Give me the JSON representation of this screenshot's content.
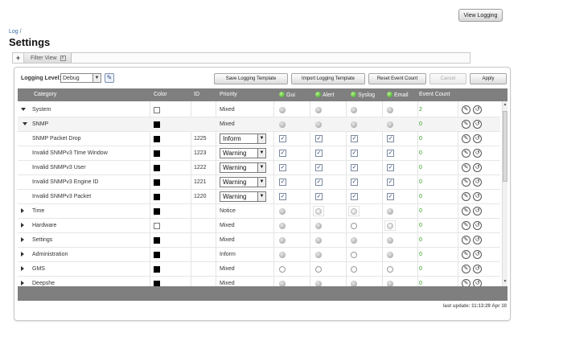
{
  "header": {
    "view_logging": "View Logging",
    "breadcrumb": "Log /",
    "title": "Settings"
  },
  "filter": {
    "add": "+",
    "tab_label": "Filter View",
    "close": "x"
  },
  "toolbar": {
    "level_label": "Logging Level:",
    "level_value": "Debug",
    "save_template": "Save Logging Template",
    "import_template": "Import Logging Template",
    "reset_count": "Reset Event Count",
    "cancel": "Cancel",
    "apply": "Apply"
  },
  "columns": {
    "category": "Category",
    "color": "Color",
    "id": "ID",
    "priority": "Priority",
    "gui": "Gui",
    "alert": "Alert",
    "syslog": "Syslog",
    "email": "Email",
    "event_count": "Event Count"
  },
  "rows": [
    {
      "name": "System",
      "color": "white",
      "id": "",
      "priority": "Mixed",
      "gui": "gray",
      "alert": "gray",
      "syslog": "gray",
      "email": "gray",
      "count": "2",
      "expand": "down",
      "indent": 0
    },
    {
      "name": "SNMP",
      "color": "black",
      "id": "",
      "priority": "Mixed",
      "gui": "gray",
      "alert": "gray",
      "syslog": "gray",
      "email": "gray",
      "count": "0",
      "expand": "down",
      "indent": 1
    },
    {
      "name": "SNMP Packet Drop",
      "color": "black",
      "id": "1225",
      "priority_select": "Inform",
      "gui": "check",
      "alert": "check",
      "syslog": "check",
      "email": "check",
      "count": "0",
      "expand": "none",
      "indent": 2
    },
    {
      "name": "Invalid SNMPv3 Time Window",
      "color": "black",
      "id": "1223",
      "priority_select": "Warning",
      "gui": "check",
      "alert": "check",
      "syslog": "check",
      "email": "check",
      "count": "0",
      "expand": "none",
      "indent": 2
    },
    {
      "name": "Invalid SNMPv3 User",
      "color": "black",
      "id": "1222",
      "priority_select": "Warning",
      "gui": "check",
      "alert": "check",
      "syslog": "check",
      "email": "check",
      "count": "0",
      "expand": "none",
      "indent": 2
    },
    {
      "name": "Invalid SNMPv3 Engine ID",
      "color": "black",
      "id": "1221",
      "priority_select": "Warning",
      "gui": "check",
      "alert": "check",
      "syslog": "check",
      "email": "check",
      "count": "0",
      "expand": "none",
      "indent": 2
    },
    {
      "name": "Invalid SNMPv3 Packet",
      "color": "black",
      "id": "1220",
      "priority_select": "Warning",
      "gui": "check",
      "alert": "check",
      "syslog": "check",
      "email": "check",
      "count": "0",
      "expand": "none",
      "indent": 2
    },
    {
      "name": "Time",
      "color": "black",
      "id": "",
      "priority": "Notice",
      "gui": "gray",
      "alert": "hg",
      "syslog": "hg",
      "email": "gray",
      "count": "0",
      "expand": "right",
      "indent": 0
    },
    {
      "name": "Hardware",
      "color": "white",
      "id": "",
      "priority": "Mixed",
      "gui": "gray",
      "alert": "gray",
      "syslog": "empty",
      "email": "hg",
      "count": "0",
      "expand": "right",
      "indent": 0
    },
    {
      "name": "Settings",
      "color": "black",
      "id": "",
      "priority": "Mixed",
      "gui": "gray",
      "alert": "gray",
      "syslog": "gray",
      "email": "gray",
      "count": "0",
      "expand": "right",
      "indent": 0
    },
    {
      "name": "Administration",
      "color": "black",
      "id": "",
      "priority": "Inform",
      "gui": "gray",
      "alert": "gray",
      "syslog": "empty",
      "email": "gray",
      "count": "0",
      "expand": "right",
      "indent": 0
    },
    {
      "name": "GMS",
      "color": "black",
      "id": "",
      "priority": "Mixed",
      "gui": "empty",
      "alert": "empty",
      "syslog": "empty",
      "email": "empty",
      "count": "0",
      "expand": "right",
      "indent": 0
    },
    {
      "name": "Deepshe",
      "color": "black",
      "id": "",
      "priority": "Mixed",
      "gui": "gray",
      "alert": "gray",
      "syslog": "gray",
      "email": "gray",
      "count": "0",
      "expand": "right",
      "indent": 0
    }
  ],
  "icons": {
    "edit": "pencil-icon",
    "delete": "reset-icon",
    "wand": "wand-icon"
  },
  "status": {
    "last_update": "last update: 11:13:29 Apr 10"
  },
  "colors": {
    "header_bg": "#7f7f7f",
    "count_green": "#2e9d1a",
    "link_blue": "#3a6ea5"
  }
}
